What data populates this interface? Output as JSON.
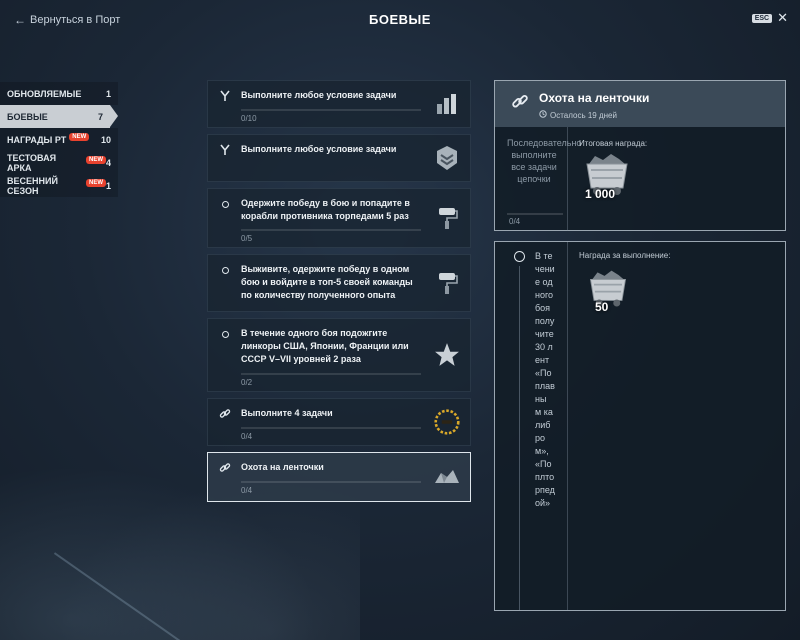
{
  "header": {
    "back_label": "Вернуться в Порт",
    "title": "БОЕВЫЕ",
    "esc_label": "ESC"
  },
  "sidebar": {
    "items": [
      {
        "label": "ОБНОВЛЯЕМЫЕ",
        "count": "1",
        "badge": "",
        "active": false
      },
      {
        "label": "БОЕВЫЕ",
        "count": "7",
        "badge": "",
        "active": true
      },
      {
        "label": "НАГРАДЫ РТ",
        "count": "10",
        "badge": "NEW",
        "active": false
      },
      {
        "label": "ТЕСТОВАЯ АРКА",
        "count": "4",
        "badge": "NEW",
        "active": false
      },
      {
        "label": "ВЕСЕННИЙ СЕЗОН",
        "count": "1",
        "badge": "NEW",
        "active": false
      }
    ]
  },
  "tasks": [
    {
      "text": "Выполните любое условие задачи",
      "progress": "0/10",
      "progress_fraction": 0,
      "icon": "branch-icon",
      "reward_icon": "bars-reward-icon"
    },
    {
      "text": "Выполните любое условие задачи",
      "progress": "",
      "progress_fraction": 0,
      "icon": "branch-icon",
      "reward_icon": "chevron-rank-reward-icon"
    },
    {
      "text": "Одержите победу в бою и попадите в корабли противника торпедами 5 раз",
      "progress": "0/5",
      "progress_fraction": 0,
      "icon": "circle-icon",
      "reward_icon": "paint-roller-reward-icon"
    },
    {
      "text": "Выживите, одержите победу в одном бою и войдите в топ-5 своей команды по количеству полученного опыта",
      "progress": "",
      "progress_fraction": 0,
      "icon": "circle-icon",
      "reward_icon": "paint-roller-reward-icon"
    },
    {
      "text": "В течение одного боя подожгите линкоры США, Японии, Франции или СССР V–VII уровней 2 раза",
      "progress": "0/2",
      "progress_fraction": 0,
      "icon": "circle-icon",
      "reward_icon": "star-reward-icon"
    },
    {
      "text": "Выполните 4 задачи",
      "progress": "0/4",
      "progress_fraction": 0,
      "icon": "link-icon",
      "reward_icon": "laurel-wreath-reward-icon"
    },
    {
      "text": "Охота на ленточки",
      "progress": "0/4",
      "progress_fraction": 0,
      "icon": "link-icon",
      "reward_icon": "coal-reward-icon",
      "selected": true
    }
  ],
  "detail": {
    "title": "Охота на ленточки",
    "time_left": "Осталось 19 дней",
    "description": "Последовательно выполните все задачи цепочки",
    "progress": "0/4",
    "reward_label": "Итоговая награда:",
    "reward_value": "1 000",
    "reward_icon": "coal-cart-icon"
  },
  "subtask": {
    "description": "В течение одного боя получите 30 лент «Поплавны м калибром», «Поплторпедой»",
    "reward_label": "Награда за выполнение:",
    "reward_value": "50",
    "reward_icon": "coal-cart-icon"
  }
}
